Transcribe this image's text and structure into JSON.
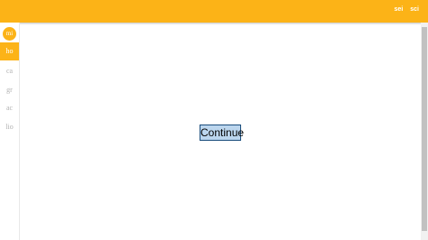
{
  "header": {
    "background_color": "#fcb317",
    "actions": [
      "sei",
      "sci"
    ]
  },
  "sidebar": {
    "avatar_label": "mi",
    "items": [
      {
        "label": "ho",
        "active": true
      },
      {
        "label": "ca",
        "active": false
      },
      {
        "label": "gr",
        "active": false
      },
      {
        "label": "ac",
        "active": false
      },
      {
        "label": "lio",
        "active": false
      }
    ]
  },
  "main": {
    "continue_label": "Continue"
  }
}
